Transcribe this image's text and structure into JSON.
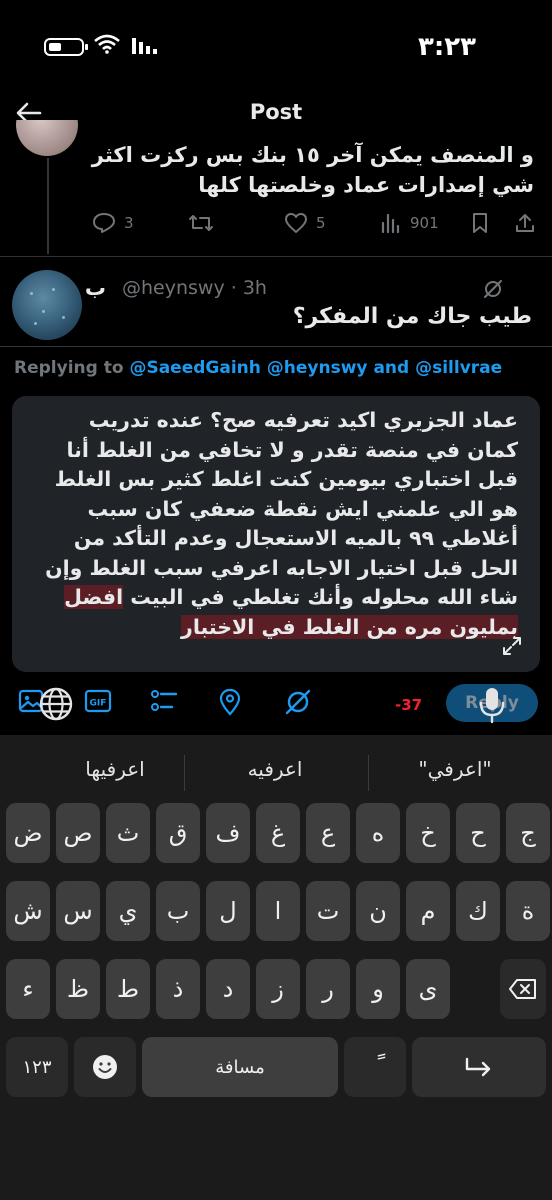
{
  "status": {
    "time": "٣:٢٣"
  },
  "header": {
    "title": "Post"
  },
  "prev_tweet": {
    "text": "و المنصف يمكن آخر ١٥ بنك بس ركزت اكثر شي إصدارات عماد وخلصتها كلها",
    "replies": "3",
    "likes": "5",
    "views": "901"
  },
  "reply_tweet": {
    "name": "ب",
    "handle": "@heynswy · 3h",
    "text": "طيب جاك من المفكر؟"
  },
  "replying_to": {
    "prefix": "Replying to",
    "m1": "@SaeedGainh",
    "m2": "@heynswy",
    "and": "and",
    "m3": "@sillvrae"
  },
  "compose": {
    "text_main": "عماد الجزيري اكيد تعرفيه صح؟ عنده تدريب كمان في منصة تقدر و لا تخافي من الغلط أنا قبل اختباري بيومين كنت اغلط كثير بس الغلط هو الي علمني ايش نقطة ضعفي كان سبب أغلاطي ٩٩ بالميه الاستعجال وعدم التأكد من الحل قبل اختيار الاجابه اعرفي سبب الغلط وإن شاء الله محلوله وأنك تغلطي في البيت ",
    "text_over": "افضل بمليون مره من الغلط في الاختبار",
    "counter": "-37",
    "reply_label": "Reply"
  },
  "keyboard": {
    "suggestions": [
      "اعرفيها",
      "اعرفيه",
      "\"اعرفي\""
    ],
    "row1": [
      "ض",
      "ص",
      "ث",
      "ق",
      "ف",
      "غ",
      "ع",
      "ه",
      "خ",
      "ح",
      "ج"
    ],
    "row2": [
      "ش",
      "س",
      "ي",
      "ب",
      "ل",
      "ا",
      "ت",
      "ن",
      "م",
      "ك",
      "ة"
    ],
    "row3": [
      "ء",
      "ظ",
      "ط",
      "ذ",
      "د",
      "ز",
      "ر",
      "و",
      "ى"
    ],
    "num_label": "١٢٣",
    "tanween": "ً",
    "space_label": "مسافة"
  },
  "colors": {
    "accent": "#1d9bf0",
    "error": "#f4212e",
    "highlight": "#5c1e25"
  }
}
